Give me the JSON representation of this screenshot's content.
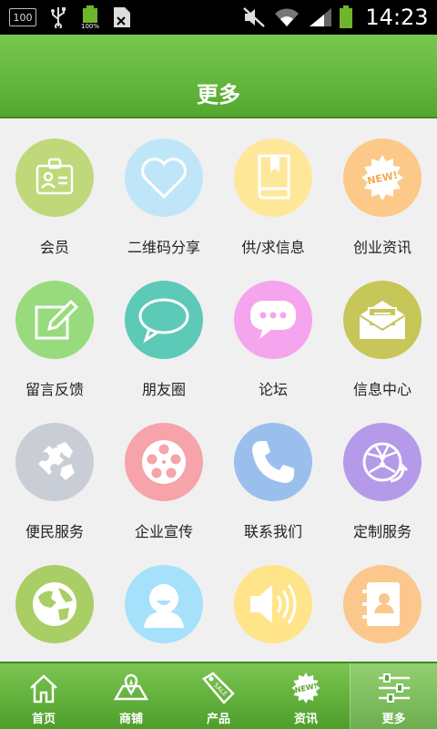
{
  "status_bar": {
    "notification_badge": "100",
    "time": "14:23",
    "icons": [
      "usb-icon",
      "battery-full-icon",
      "document-icon",
      "mute-icon",
      "wifi-icon",
      "signal-icon",
      "battery-icon"
    ]
  },
  "header": {
    "title": "更多"
  },
  "colors": {
    "brand_green": "#5bb033",
    "header_gradient": [
      "#78c850",
      "#54a82e"
    ]
  },
  "grid": {
    "items": [
      {
        "label": "会员",
        "icon": "member-card-icon",
        "color": "#bfd97a"
      },
      {
        "label": "二维码分享",
        "icon": "heart-icon",
        "color": "#bfe6f8"
      },
      {
        "label": "供/求信息",
        "icon": "book-icon",
        "color": "#ffe79a"
      },
      {
        "label": "创业资讯",
        "icon": "new-badge-icon",
        "color": "#fcc989"
      },
      {
        "label": "留言反馈",
        "icon": "note-edit-icon",
        "color": "#97db7e"
      },
      {
        "label": "朋友圈",
        "icon": "chat-bubble-icon",
        "color": "#5dc9b7"
      },
      {
        "label": "论坛",
        "icon": "forum-bubble-icon",
        "color": "#f5a4ee"
      },
      {
        "label": "信息中心",
        "icon": "envelope-icon",
        "color": "#c6c659"
      },
      {
        "label": "便民服务",
        "icon": "puzzle-icon",
        "color": "#c9cdd5"
      },
      {
        "label": "企业宣传",
        "icon": "film-reel-icon",
        "color": "#f6a3a9"
      },
      {
        "label": "联系我们",
        "icon": "phone-icon",
        "color": "#9bbfed"
      },
      {
        "label": "定制服务",
        "icon": "globe-network-icon",
        "color": "#b49ae9"
      },
      {
        "label": "",
        "icon": "world-icon",
        "color": "#a9ce65"
      },
      {
        "label": "",
        "icon": "user-icon",
        "color": "#a6e1fb"
      },
      {
        "label": "",
        "icon": "speaker-icon",
        "color": "#ffe48a"
      },
      {
        "label": "",
        "icon": "contacts-book-icon",
        "color": "#fcc78c"
      }
    ]
  },
  "tab_bar": {
    "tabs": [
      {
        "label": "首页",
        "icon": "home-icon",
        "active": false
      },
      {
        "label": "商铺",
        "icon": "shop-map-icon",
        "active": false
      },
      {
        "label": "产品",
        "icon": "sale-tag-icon",
        "active": false
      },
      {
        "label": "资讯",
        "icon": "new-badge-icon",
        "active": false
      },
      {
        "label": "更多",
        "icon": "sliders-icon",
        "active": true
      }
    ]
  }
}
